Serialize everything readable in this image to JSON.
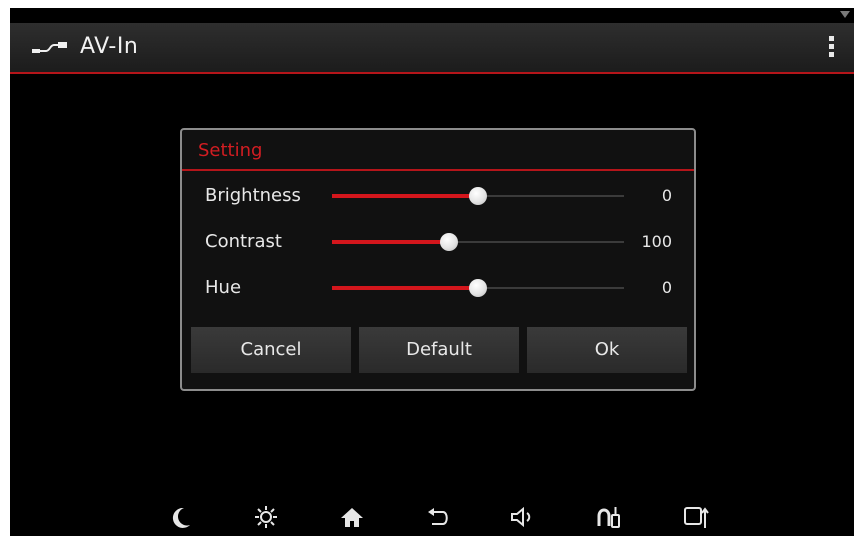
{
  "app": {
    "title": "AV-In",
    "icon": "cable-plug-icon",
    "menu_icon": "more-vertical-icon"
  },
  "dialog": {
    "title": "Setting",
    "rows": [
      {
        "label": "Brightness",
        "value": "0",
        "level": 0.5
      },
      {
        "label": "Contrast",
        "value": "100",
        "level": 0.4
      },
      {
        "label": "Hue",
        "value": "0",
        "level": 0.5
      }
    ],
    "buttons": {
      "cancel": "Cancel",
      "default": "Default",
      "ok": "Ok"
    }
  },
  "bottom_nav": [
    {
      "icon": "night-mode-icon"
    },
    {
      "icon": "brightness-icon"
    },
    {
      "icon": "home-icon"
    },
    {
      "icon": "back-icon"
    },
    {
      "icon": "volume-icon"
    },
    {
      "icon": "phone-projection-icon"
    },
    {
      "icon": "device-connect-icon"
    }
  ],
  "colors": {
    "accent": "#d4161c",
    "background": "#000000",
    "dialog_border": "#8c8c8c",
    "button": "#333333"
  }
}
